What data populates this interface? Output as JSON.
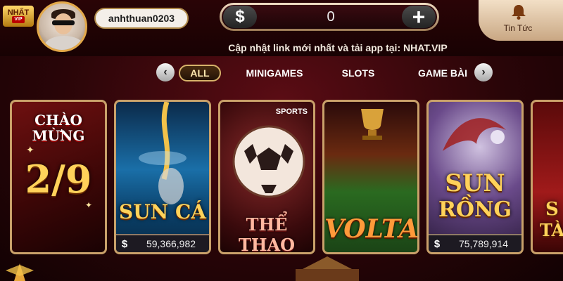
{
  "header": {
    "logo_main": "NHẤT",
    "logo_sub": "VIP",
    "username": "anhthuan0203",
    "balance_symbol": "$",
    "balance": "0",
    "add_symbol": "+",
    "news_label": "Tin Tức",
    "announcement": "Cập nhật link mới nhất và tải app tại: NHAT.VIP"
  },
  "tabs": {
    "prev": "‹",
    "next": "›",
    "items": [
      {
        "label": "ALL"
      },
      {
        "label": "MINIGAMES"
      },
      {
        "label": "SLOTS"
      },
      {
        "label": "GAME BÀI"
      }
    ]
  },
  "games": [
    {
      "title_line1": "CHÀO",
      "title_line2": "MỪNG",
      "big": "2/9"
    },
    {
      "title": "SUN CÁ",
      "jackpot_symbol": "$",
      "jackpot": "59,366,982"
    },
    {
      "badge": "SPORTS",
      "title": "THỂ THAO"
    },
    {
      "title": "VOLTA"
    },
    {
      "title_line1": "SUN",
      "title_line2": "RỒNG",
      "jackpot_symbol": "$",
      "jackpot": "75,789,914"
    },
    {
      "title_line1": "S",
      "title_line2": "TÀ"
    }
  ],
  "colors": {
    "gold": "#ffd25a",
    "background": "#2a0508",
    "card_border": "#c9a16a"
  }
}
